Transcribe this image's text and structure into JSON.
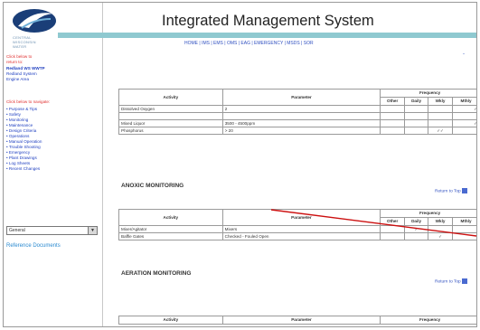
{
  "app": {
    "title": "Integrated Management System"
  },
  "logo": {
    "lines": [
      "CENTRAL",
      "WISCONSIN",
      "WATER"
    ]
  },
  "sidebar": {
    "click_back": "Click below to",
    "return_to": "return to:",
    "facility": "Redland WS WWTP",
    "sub1": "Redland System",
    "sub2": "Engine Area",
    "click_navigate": "Click below to navigate:",
    "nav_items": [
      "Purpose & Tips",
      "Safety",
      "Monitoring",
      "Maintenance",
      "Design Criteria",
      "Operations",
      "Manual Operation",
      "Trouble Shooting",
      "Emergency",
      "Plant Drawings",
      "Log Sheets",
      "Recent Changes"
    ],
    "dropdown_value": "General",
    "reference_link": "Reference Documents"
  },
  "topnav": "HOME | IMS | EMS | OMS | EAG | EMERGENCY | MSDS | SOR",
  "tables": {
    "headers": {
      "activity": "Activity",
      "parameter": "Parameter",
      "frequency": "Frequency",
      "other": "Other",
      "daily": "Daily",
      "wkly": "Wkly",
      "mthly": "Mthly"
    },
    "top_rows": [
      {
        "activity": "Dissolved Oxygen",
        "parameter": "2",
        "other": "",
        "daily": "",
        "wkly": "",
        "mthly": "✓"
      },
      {
        "activity": "Mixed Liquor",
        "parameter": "3500 - 4500ppm",
        "other": "",
        "daily": "",
        "wkly": "",
        "mthly": "✓"
      },
      {
        "activity": "Phosphorus",
        "parameter": "> 20",
        "other": "",
        "daily": "",
        "wkly": "✓✓",
        "mthly": ""
      }
    ],
    "anoxic_rows": [
      {
        "activity": "Mixer/Agitator",
        "parameter": "Mixers",
        "other": "",
        "daily": "✓",
        "wkly": "",
        "mthly": ""
      },
      {
        "activity": "Baffle Gates",
        "parameter": "Checked - Fouled Open",
        "other": "",
        "daily": "",
        "wkly": "✓",
        "mthly": ""
      }
    ]
  },
  "sections": {
    "anoxic": "ANOXIC MONITORING",
    "aeration": "AERATION MONITORING",
    "return_top": "Return to Top"
  },
  "colors": {
    "teal_bar": "#8fc9d0",
    "annotation_line": "#cc1010",
    "link": "#3050c0",
    "red_text": "#e03030"
  }
}
